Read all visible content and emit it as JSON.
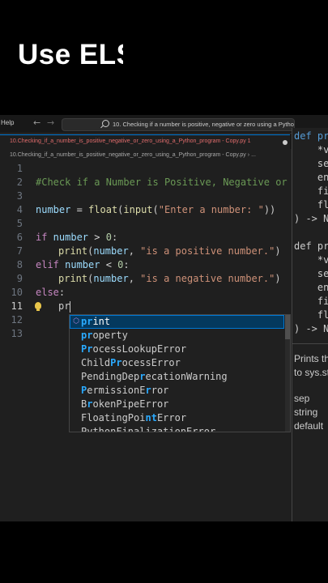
{
  "caption": "Use ELS",
  "titlebar": {
    "menu_help": "Help",
    "back_arrow": "←",
    "forward_arrow": "→",
    "search_text": "10. Checking if a number is positive, negative or zero using a Python program"
  },
  "tab": {
    "label": "10.Checking_if_a_number_is_positive_negative_or_zero_using_a_Python_program - Copy.py 1"
  },
  "breadcrumb": {
    "file": "10.Checking_if_a_number_is_positive_negative_or_zero_using_a_Python_program - Copy.py",
    "sep": "›",
    "tail": "..."
  },
  "editor": {
    "line_numbers": [
      "1",
      "2",
      "3",
      "4",
      "5",
      "6",
      "7",
      "8",
      "9",
      "10",
      "11",
      "12",
      "13"
    ],
    "line2_comment": "#Check if a Number is Positive, Negative or Ze",
    "line4": {
      "var": "number",
      "eq": " = ",
      "float": "float",
      "p1": "(",
      "input": "input",
      "p2": "(",
      "str": "\"Enter a number: \"",
      "p3": "))"
    },
    "line6": {
      "kw": "if",
      "var": " number",
      "op": " > ",
      "num": "0",
      "colon": ":"
    },
    "line7": {
      "fn": "print",
      "p1": "(",
      "var": "number",
      "comma": ", ",
      "str": "\"is a positive number.\"",
      "p2": ")"
    },
    "line8": {
      "kw": "elif",
      "var": " number",
      "op": " < ",
      "num": "0",
      "colon": ":"
    },
    "line9": {
      "fn": "print",
      "p1": "(",
      "var": "number",
      "comma": ", ",
      "str": "\"is a negative number.\"",
      "p2": ")"
    },
    "line10": {
      "kw": "else",
      "colon": ":"
    },
    "line11_typed": "pr"
  },
  "suggestions": {
    "items": [
      {
        "match": "pr",
        "rest": "int",
        "icon": "cube-icon"
      },
      {
        "match": "pr",
        "rest": "operty",
        "icon": "none"
      },
      {
        "pre": "",
        "label_a": "",
        "full": "ProcessLookupError",
        "parts": [
          "P",
          "r",
          "ocessLookupError"
        ]
      },
      {
        "full": "ChildProcessError",
        "parts": [
          "Child",
          "Pr",
          "ocessError"
        ]
      },
      {
        "full": "PendingDeprecationWarning",
        "parts": [
          "PendingDep",
          "r",
          "ecationWarning"
        ]
      },
      {
        "full": "PermissionError",
        "parts": [
          "P",
          "ermissionE",
          "r",
          "ror"
        ]
      },
      {
        "full": "BrokenPipeError",
        "parts": [
          "B",
          "r",
          "okenPipeError"
        ]
      },
      {
        "full": "FloatingPointError",
        "parts": [
          "FloatingPoi",
          "nt",
          "Error"
        ]
      },
      {
        "full": "PythonFinalizationError"
      }
    ]
  },
  "right_panel": {
    "sig1": [
      "def pr",
      "    *va",
      "    sep",
      "    end",
      "    fil",
      "    flu",
      ") -> No"
    ],
    "sig2": [
      "def pr",
      "    *va",
      "    sep",
      "    end",
      "    fil",
      "    flu",
      ") -> No"
    ],
    "doc": [
      "Prints th",
      "to sys.st",
      "",
      "sep",
      "  string",
      "default"
    ]
  },
  "colors": {
    "editor_bg": "#1f1f1f",
    "keyword": "#c586c0",
    "function": "#dcdcaa",
    "variable": "#9cdcfe",
    "string": "#ce9178",
    "number": "#b5cea8",
    "comment": "#6a9955",
    "highlight": "#2aaaff"
  }
}
